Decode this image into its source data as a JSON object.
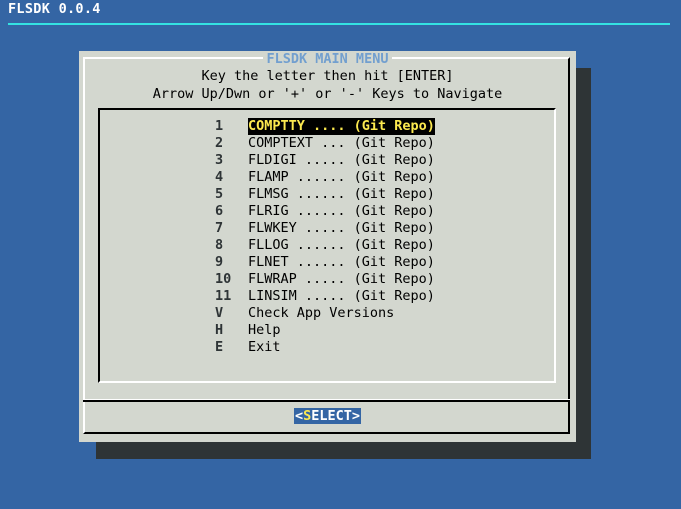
{
  "backtitle": "FLSDK 0.0.4",
  "dialog": {
    "title": "FLSDK MAIN MENU",
    "prompt_line1": "Key the letter then hit [ENTER]",
    "prompt_line2": "Arrow Up/Dwn or '+' or '-' Keys to Navigate"
  },
  "menu": [
    {
      "tag": "1",
      "label": "COMPTTY .... (Git Repo)",
      "selected": true
    },
    {
      "tag": "2",
      "label": "COMPTEXT ... (Git Repo)"
    },
    {
      "tag": "3",
      "label": "FLDIGI ..... (Git Repo)"
    },
    {
      "tag": "4",
      "label": "FLAMP ...... (Git Repo)"
    },
    {
      "tag": "5",
      "label": "FLMSG ...... (Git Repo)"
    },
    {
      "tag": "6",
      "label": "FLRIG ...... (Git Repo)"
    },
    {
      "tag": "7",
      "label": "FLWKEY ..... (Git Repo)"
    },
    {
      "tag": "8",
      "label": "FLLOG ...... (Git Repo)"
    },
    {
      "tag": "9",
      "label": "FLNET ...... (Git Repo)"
    },
    {
      "tag": "10",
      "label": "FLWRAP ..... (Git Repo)"
    },
    {
      "tag": "11",
      "label": "LINSIM ..... (Git Repo)"
    },
    {
      "tag": "V",
      "label": "Check App Versions"
    },
    {
      "tag": "H",
      "label": "Help"
    },
    {
      "tag": "E",
      "label": "Exit"
    }
  ],
  "buttons": {
    "select": {
      "open": "<",
      "hot": "S",
      "rest": "ELECT",
      "close": ">"
    }
  },
  "colors": {
    "desktop": "#3465a4",
    "dialog": "#d3d7cf",
    "title": "#729fcf",
    "highlight_text": "#fce94f",
    "highlight_bg": "#000000",
    "rule": "#34e2e2"
  }
}
